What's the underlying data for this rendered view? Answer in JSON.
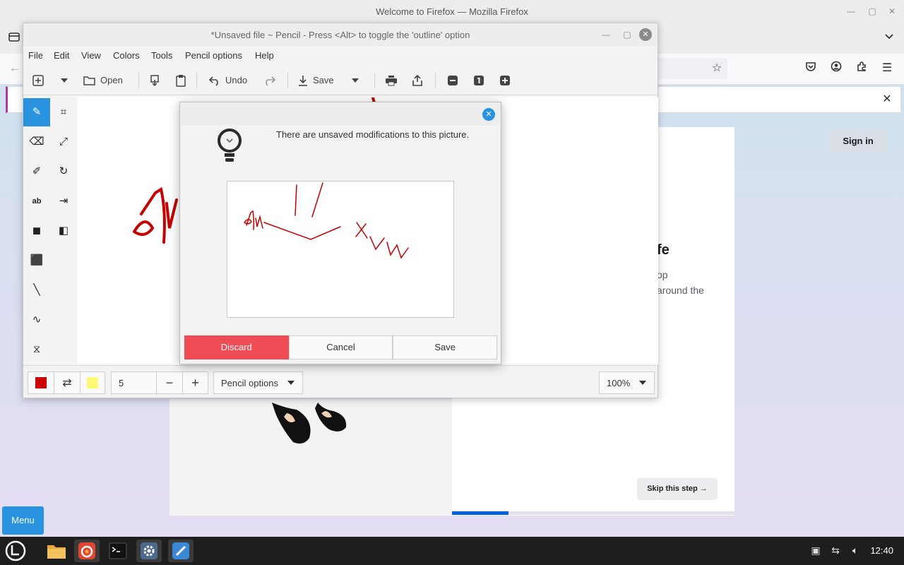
{
  "firefox": {
    "title": "Welcome to Firefox — Mozilla Firefox",
    "sign_in": "Sign in",
    "heading_fragment": "fe",
    "text_fragment_1": "op",
    "text_fragment_2": "around the",
    "skip_label": "Skip this step →",
    "progress": 0.2
  },
  "pencil": {
    "title": "*Unsaved file ~ Pencil - Press <Alt> to toggle the 'outline' option",
    "menu": [
      "File",
      "Edit",
      "View",
      "Colors",
      "Tools",
      "Pencil options",
      "Help"
    ],
    "toolbar": {
      "open": "Open",
      "undo": "Undo",
      "save": "Save"
    },
    "bottom": {
      "size_value": "5",
      "size_unit": "px",
      "options_label": "Pencil options",
      "zoom": "100%",
      "primary_color": "#cc0000",
      "secondary_color": "#fff976"
    }
  },
  "dialog": {
    "message": "There are unsaved modifications to this picture.",
    "buttons": {
      "discard": "Discard",
      "cancel": "Cancel",
      "save": "Save"
    }
  },
  "desktop": {
    "menu_button": "Menu",
    "clock": "12:40"
  }
}
